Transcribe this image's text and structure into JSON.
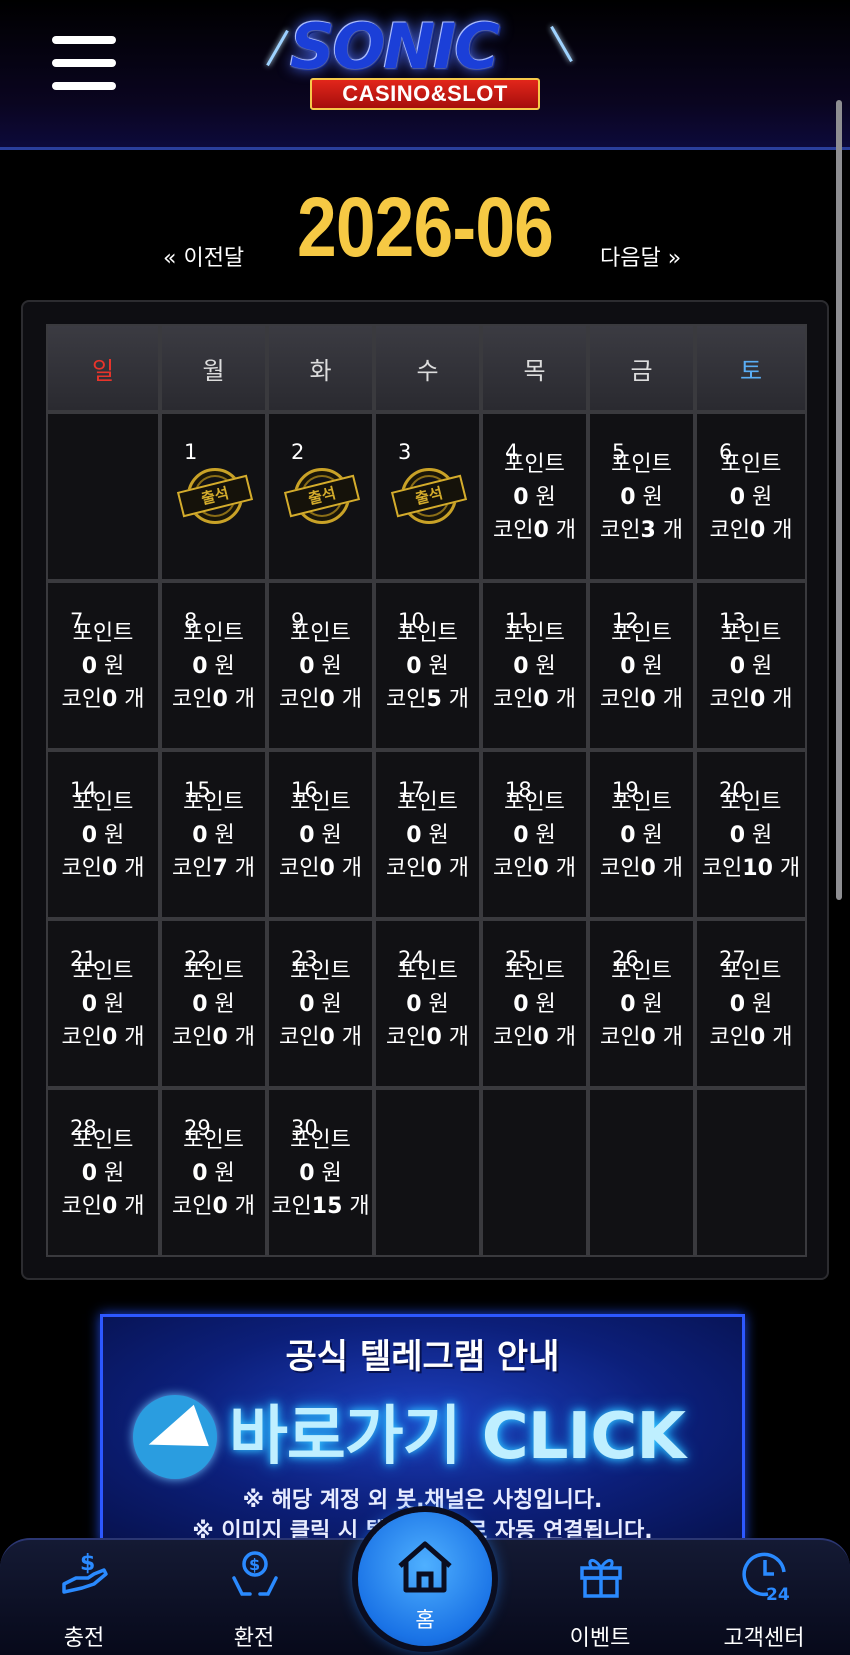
{
  "header": {
    "logo_main": "SONIC",
    "logo_sub": "CASINO&SLOT"
  },
  "month_nav": {
    "prev_label": "« 이전달",
    "title": "2026-06",
    "next_label": "다음달 »"
  },
  "calendar": {
    "weekdays": [
      "일",
      "월",
      "화",
      "수",
      "목",
      "금",
      "토"
    ],
    "stamp_text": "출석",
    "weeks": [
      [
        {
          "day": "",
          "kind": "empty"
        },
        {
          "day": "1",
          "kind": "stamp"
        },
        {
          "day": "2",
          "kind": "stamp"
        },
        {
          "day": "3",
          "kind": "stamp"
        },
        {
          "day": "4",
          "kind": "info",
          "point_label": "포인트",
          "points": "0",
          "won": "원",
          "coin_label": "코인",
          "coins": "0",
          "coin_unit": "개"
        },
        {
          "day": "5",
          "kind": "info",
          "point_label": "포인트",
          "points": "0",
          "won": "원",
          "coin_label": "코인",
          "coins": "3",
          "coin_unit": "개"
        },
        {
          "day": "6",
          "kind": "info",
          "point_label": "포인트",
          "points": "0",
          "won": "원",
          "coin_label": "코인",
          "coins": "0",
          "coin_unit": "개"
        }
      ],
      [
        {
          "day": "7",
          "kind": "info",
          "point_label": "포인트",
          "points": "0",
          "won": "원",
          "coin_label": "코인",
          "coins": "0",
          "coin_unit": "개"
        },
        {
          "day": "8",
          "kind": "info",
          "point_label": "포인트",
          "points": "0",
          "won": "원",
          "coin_label": "코인",
          "coins": "0",
          "coin_unit": "개"
        },
        {
          "day": "9",
          "kind": "info",
          "point_label": "포인트",
          "points": "0",
          "won": "원",
          "coin_label": "코인",
          "coins": "0",
          "coin_unit": "개"
        },
        {
          "day": "10",
          "kind": "info",
          "point_label": "포인트",
          "points": "0",
          "won": "원",
          "coin_label": "코인",
          "coins": "5",
          "coin_unit": "개"
        },
        {
          "day": "11",
          "kind": "info",
          "point_label": "포인트",
          "points": "0",
          "won": "원",
          "coin_label": "코인",
          "coins": "0",
          "coin_unit": "개"
        },
        {
          "day": "12",
          "kind": "info",
          "point_label": "포인트",
          "points": "0",
          "won": "원",
          "coin_label": "코인",
          "coins": "0",
          "coin_unit": "개"
        },
        {
          "day": "13",
          "kind": "info",
          "point_label": "포인트",
          "points": "0",
          "won": "원",
          "coin_label": "코인",
          "coins": "0",
          "coin_unit": "개"
        }
      ],
      [
        {
          "day": "14",
          "kind": "info",
          "point_label": "포인트",
          "points": "0",
          "won": "원",
          "coin_label": "코인",
          "coins": "0",
          "coin_unit": "개"
        },
        {
          "day": "15",
          "kind": "info",
          "point_label": "포인트",
          "points": "0",
          "won": "원",
          "coin_label": "코인",
          "coins": "7",
          "coin_unit": "개"
        },
        {
          "day": "16",
          "kind": "info",
          "point_label": "포인트",
          "points": "0",
          "won": "원",
          "coin_label": "코인",
          "coins": "0",
          "coin_unit": "개"
        },
        {
          "day": "17",
          "kind": "info",
          "point_label": "포인트",
          "points": "0",
          "won": "원",
          "coin_label": "코인",
          "coins": "0",
          "coin_unit": "개"
        },
        {
          "day": "18",
          "kind": "info",
          "point_label": "포인트",
          "points": "0",
          "won": "원",
          "coin_label": "코인",
          "coins": "0",
          "coin_unit": "개"
        },
        {
          "day": "19",
          "kind": "info",
          "point_label": "포인트",
          "points": "0",
          "won": "원",
          "coin_label": "코인",
          "coins": "0",
          "coin_unit": "개"
        },
        {
          "day": "20",
          "kind": "info",
          "point_label": "포인트",
          "points": "0",
          "won": "원",
          "coin_label": "코인",
          "coins": "10",
          "coin_unit": "개"
        }
      ],
      [
        {
          "day": "21",
          "kind": "info",
          "point_label": "포인트",
          "points": "0",
          "won": "원",
          "coin_label": "코인",
          "coins": "0",
          "coin_unit": "개"
        },
        {
          "day": "22",
          "kind": "info",
          "point_label": "포인트",
          "points": "0",
          "won": "원",
          "coin_label": "코인",
          "coins": "0",
          "coin_unit": "개"
        },
        {
          "day": "23",
          "kind": "info",
          "point_label": "포인트",
          "points": "0",
          "won": "원",
          "coin_label": "코인",
          "coins": "0",
          "coin_unit": "개"
        },
        {
          "day": "24",
          "kind": "info",
          "point_label": "포인트",
          "points": "0",
          "won": "원",
          "coin_label": "코인",
          "coins": "0",
          "coin_unit": "개"
        },
        {
          "day": "25",
          "kind": "info",
          "point_label": "포인트",
          "points": "0",
          "won": "원",
          "coin_label": "코인",
          "coins": "0",
          "coin_unit": "개"
        },
        {
          "day": "26",
          "kind": "info",
          "point_label": "포인트",
          "points": "0",
          "won": "원",
          "coin_label": "코인",
          "coins": "0",
          "coin_unit": "개"
        },
        {
          "day": "27",
          "kind": "info",
          "point_label": "포인트",
          "points": "0",
          "won": "원",
          "coin_label": "코인",
          "coins": "0",
          "coin_unit": "개"
        }
      ],
      [
        {
          "day": "28",
          "kind": "info",
          "point_label": "포인트",
          "points": "0",
          "won": "원",
          "coin_label": "코인",
          "coins": "0",
          "coin_unit": "개"
        },
        {
          "day": "29",
          "kind": "info",
          "point_label": "포인트",
          "points": "0",
          "won": "원",
          "coin_label": "코인",
          "coins": "0",
          "coin_unit": "개"
        },
        {
          "day": "30",
          "kind": "info",
          "point_label": "포인트",
          "points": "0",
          "won": "원",
          "coin_label": "코인",
          "coins": "15",
          "coin_unit": "개"
        },
        {
          "day": "",
          "kind": "empty"
        },
        {
          "day": "",
          "kind": "empty"
        },
        {
          "day": "",
          "kind": "empty"
        },
        {
          "day": "",
          "kind": "empty"
        }
      ]
    ]
  },
  "banner": {
    "title": "공식 텔레그램 안내",
    "cta": "바로가기 CLICK",
    "note1": "※ 해당 계정 외 봇,채널은 사칭입니다.",
    "note2": "※ 이미지 클릭 시 텔레그램으로 자동 연결됩니다.",
    "icon": "telegram-icon"
  },
  "bottom_nav": {
    "items": [
      {
        "label": "충전",
        "icon": "deposit-icon"
      },
      {
        "label": "환전",
        "icon": "withdraw-icon"
      },
      {
        "label": "홈",
        "icon": "home-icon"
      },
      {
        "label": "이벤트",
        "icon": "gift-icon"
      },
      {
        "label": "고객센터",
        "icon": "support-24-icon"
      }
    ]
  },
  "colors": {
    "month_title": "#f6c944",
    "sunday": "#e8342b",
    "saturday": "#5aaef5",
    "accent_blue": "#1a73e6",
    "stamp_gold": "#d4ac2c"
  }
}
